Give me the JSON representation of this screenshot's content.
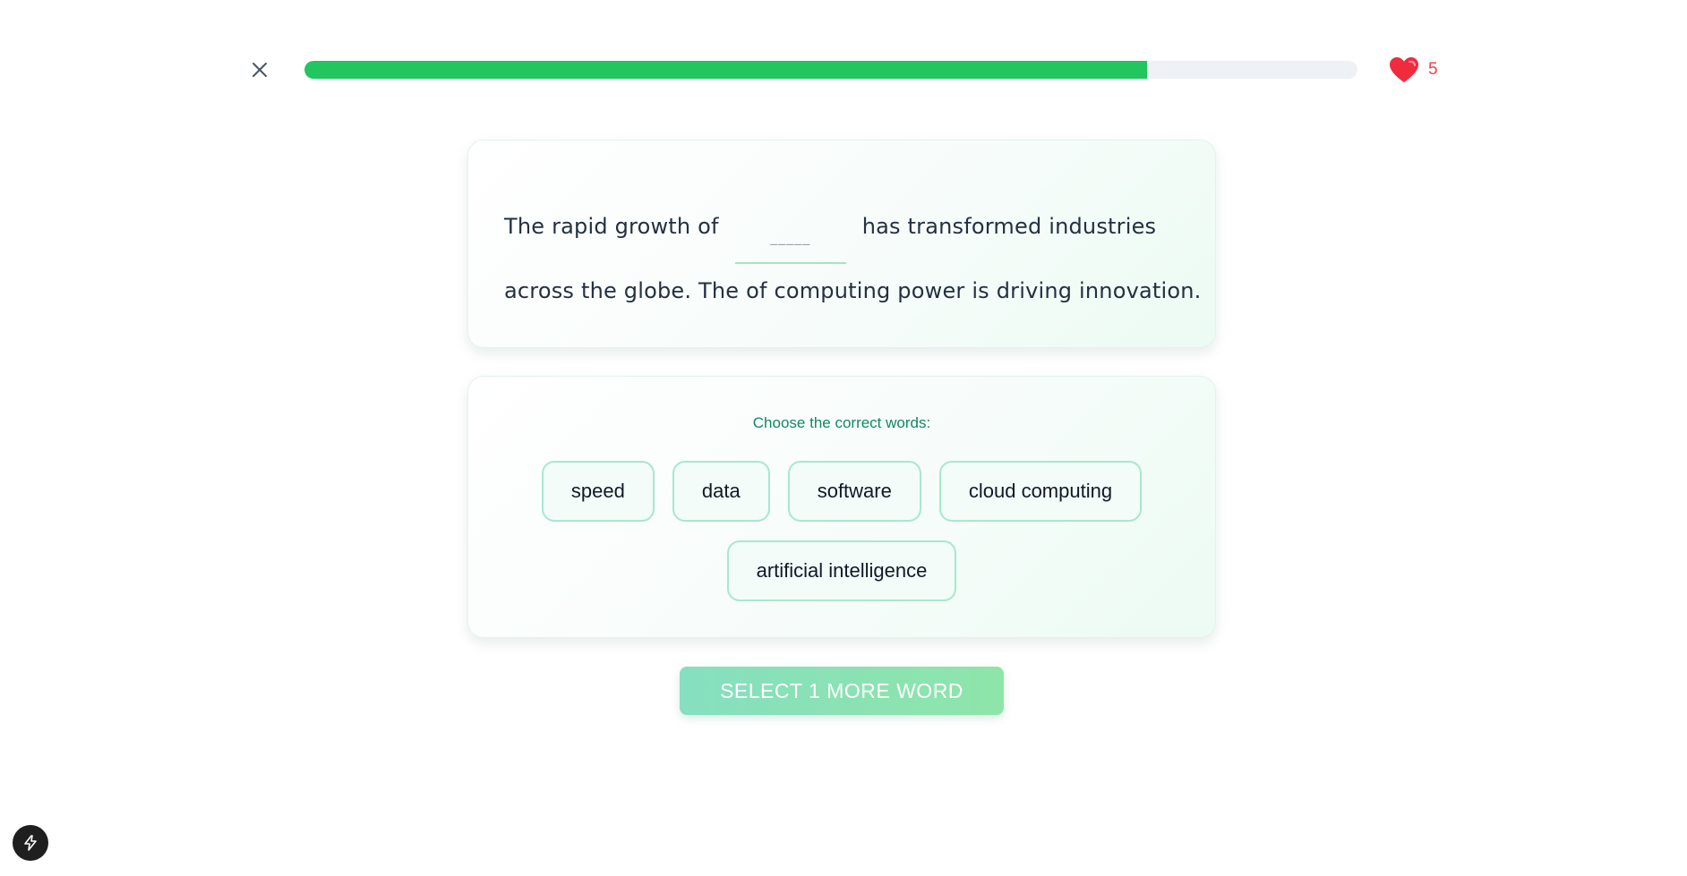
{
  "header": {
    "progress_fraction": 0.8,
    "hearts_count": "5",
    "colors": {
      "progress": "#22c55e",
      "hearts": "#ef4444"
    }
  },
  "sentence": {
    "part1": "The rapid growth of",
    "blank_placeholder": "_____",
    "part2": "has transformed industries",
    "line2": "across the globe. The of computing power is driving innovation."
  },
  "choices": {
    "prompt": "Choose the correct words:",
    "options": [
      "speed",
      "data",
      "software",
      "cloud computing",
      "artificial intelligence"
    ]
  },
  "submit": {
    "label": "SELECT 1 MORE WORD"
  },
  "icons": {
    "close": "close-icon",
    "heart": "heart-icon",
    "bolt": "lightning-icon"
  }
}
